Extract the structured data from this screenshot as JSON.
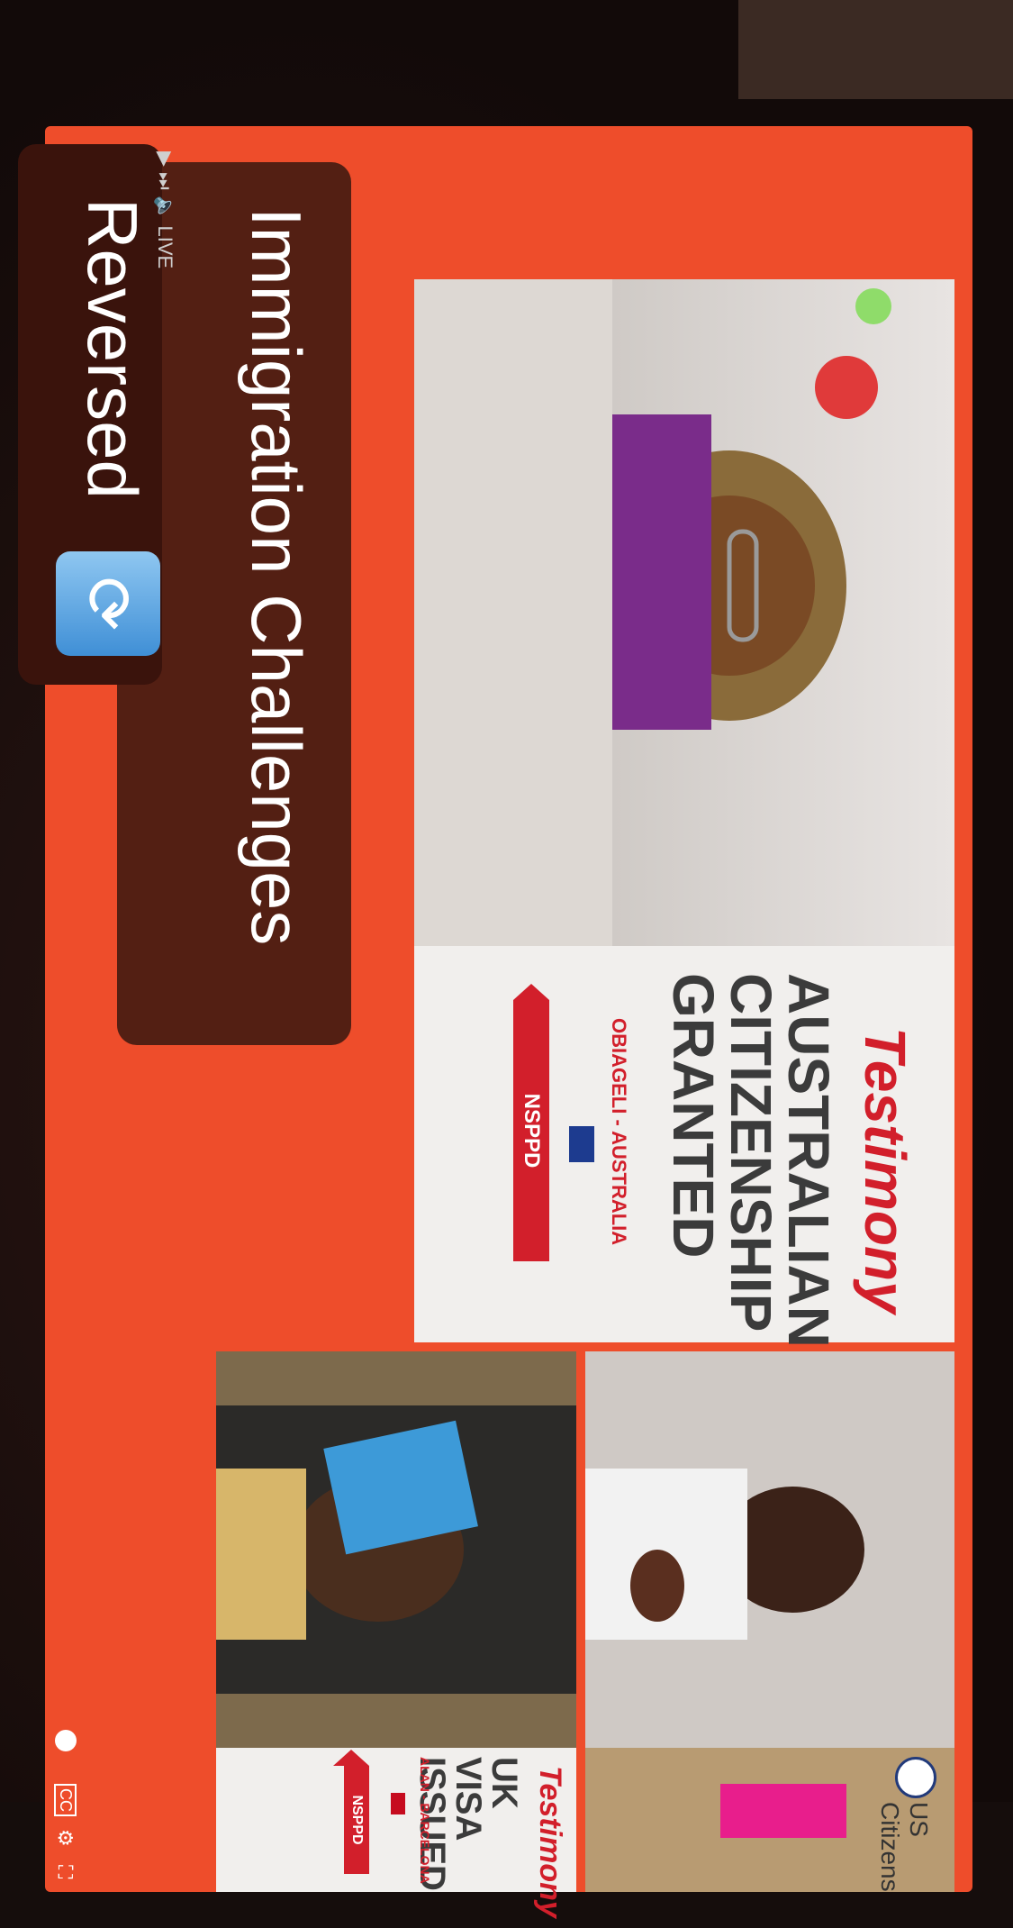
{
  "caption": {
    "line1": "Immigration Challenges",
    "line2": "Reversed",
    "icon": "refresh-icon"
  },
  "player": {
    "live_label": "LIVE",
    "play_icon": "play-icon",
    "next_icon": "next-icon",
    "volume_icon": "volume-icon",
    "cc_label": "CC",
    "settings_icon": "gear-icon",
    "fullscreen_icon": "fullscreen-icon"
  },
  "slides": [
    {
      "label": "Testimony",
      "headline_lines": [
        "AUSTRALIAN",
        "CITIZENSHIP",
        "GRANTED"
      ],
      "person": "OBIAGELI - AUSTRALIA",
      "tag": "NSPPD"
    },
    {
      "label": "Testimony",
      "headline_lines": [
        "UK VISA",
        "ISSUED"
      ],
      "person": "ALAN - BARCELONA",
      "tag": "NSPPD"
    }
  ],
  "doc_caption": "US Citizens",
  "colors": {
    "accent": "#ee4d2b",
    "testimony_red": "#d21f2b",
    "caption_bg": "#4a1c12"
  }
}
